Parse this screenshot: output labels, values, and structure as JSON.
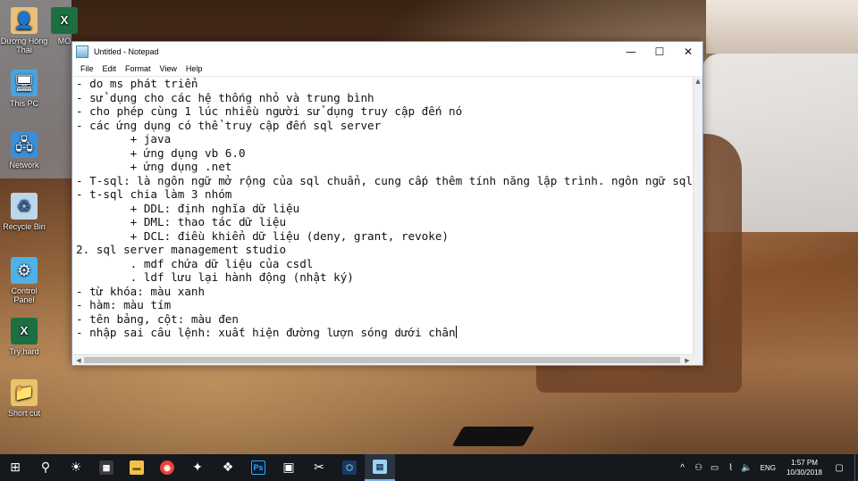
{
  "desktop": {
    "icons": [
      {
        "label": "Dương Hồng Thái",
        "glyph": "👤"
      },
      {
        "label": "MO",
        "glyph": "X"
      },
      {
        "label": "This PC",
        "glyph": "🖥"
      },
      {
        "label": "Network",
        "glyph": "🖧"
      },
      {
        "label": "Recycle Bin",
        "glyph": "♻"
      },
      {
        "label": "Control Panel",
        "glyph": "⚙"
      },
      {
        "label": "Try hard",
        "glyph": "X"
      },
      {
        "label": "Short cut",
        "glyph": "📁"
      }
    ]
  },
  "notepad": {
    "title": "Untitled - Notepad",
    "menu": [
      "File",
      "Edit",
      "Format",
      "View",
      "Help"
    ],
    "controls": {
      "minimize": "—",
      "maximize": "☐",
      "close": "✕"
    },
    "lines": [
      "- do ms phát triển",
      "- sử dụng cho các hệ thống nhỏ và trung bình",
      "- cho phép cùng 1 lúc nhiều người sử dụng truy cập đến nó",
      "- các ứng dụng có thể truy cập đến sql server",
      "        + java",
      "        + ứng dụng vb 6.0",
      "        + ứng dụng .net",
      "- T-sql: là ngôn ngữ mở rộng của sql chuẩn, cung cấp thêm tính năng lập trình. ngôn ngữ sql chuẩn",
      "- t-sql chia làm 3 nhóm",
      "        + DDL: định nghĩa dữ liệu",
      "        + DML: thao tác dữ liệu",
      "        + DCL: điều khiển dữ liệu (deny, grant, revoke)",
      "2. sql server management studio",
      "        . mdf chứa dữ liệu của csdl",
      "        . ldf lưu lại hành động (nhật ký)",
      "- từ khóa: màu xanh",
      "- hàm: màu tím",
      "- tên bảng, cột: màu đen",
      "- nhập sai câu lệnh: xuất hiện đường lượn sóng dưới chân"
    ]
  },
  "taskbar": {
    "apps": [
      {
        "name": "start",
        "glyph": "⊞"
      },
      {
        "name": "search",
        "glyph": "⚲"
      },
      {
        "name": "brightness",
        "glyph": "☀"
      },
      {
        "name": "calculator",
        "glyph": "▦"
      },
      {
        "name": "file-explorer",
        "glyph": "▬"
      },
      {
        "name": "chrome",
        "glyph": "◉"
      },
      {
        "name": "app",
        "glyph": "✦"
      },
      {
        "name": "app",
        "glyph": "❖"
      },
      {
        "name": "photoshop",
        "glyph": "Ps"
      },
      {
        "name": "app",
        "glyph": "▣"
      },
      {
        "name": "tools",
        "glyph": "✂"
      },
      {
        "name": "virtualbox",
        "glyph": "⬡"
      },
      {
        "name": "notepad",
        "glyph": "▤"
      }
    ],
    "tray": {
      "language": "ENG",
      "time": "1:57 PM",
      "date": "10/30/2018"
    }
  },
  "colors": {
    "taskbar": "#15181c",
    "active_accent": "#7fb3ff"
  }
}
